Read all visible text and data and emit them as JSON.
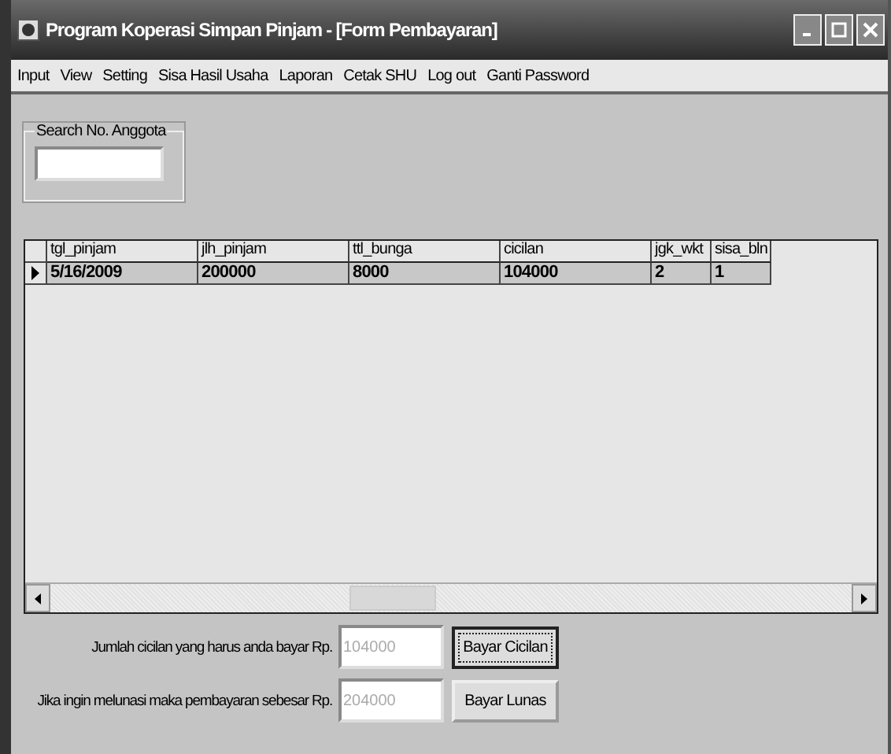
{
  "window": {
    "title": "Program Koperasi Simpan Pinjam - [Form Pembayaran]"
  },
  "menu": [
    "Input",
    "View",
    "Setting",
    "Sisa Hasil Usaha",
    "Laporan",
    "Cetak SHU",
    "Log out",
    "Ganti Password"
  ],
  "search": {
    "label": "Search No. Anggota"
  },
  "table": {
    "columns": [
      "tgl_pinjam",
      "jlh_pinjam",
      "ttl_bunga",
      "cicilan",
      "jgk_wkt",
      "sisa_bln"
    ],
    "rows": [
      {
        "selected": true,
        "cells": [
          "5/16/2009",
          "200000",
          "8000",
          "104000",
          "2",
          "1"
        ]
      }
    ]
  },
  "payments": [
    {
      "label": "Jumlah cicilan yang harus anda bayar  Rp.",
      "value": "104000",
      "disabled": true,
      "button": "Bayar Cicilan",
      "focused": true
    },
    {
      "label": "Jika ingin melunasi maka pembayaran sebesar Rp.",
      "value": "204000",
      "disabled": true,
      "button": "Bayar Lunas",
      "focused": false
    }
  ]
}
